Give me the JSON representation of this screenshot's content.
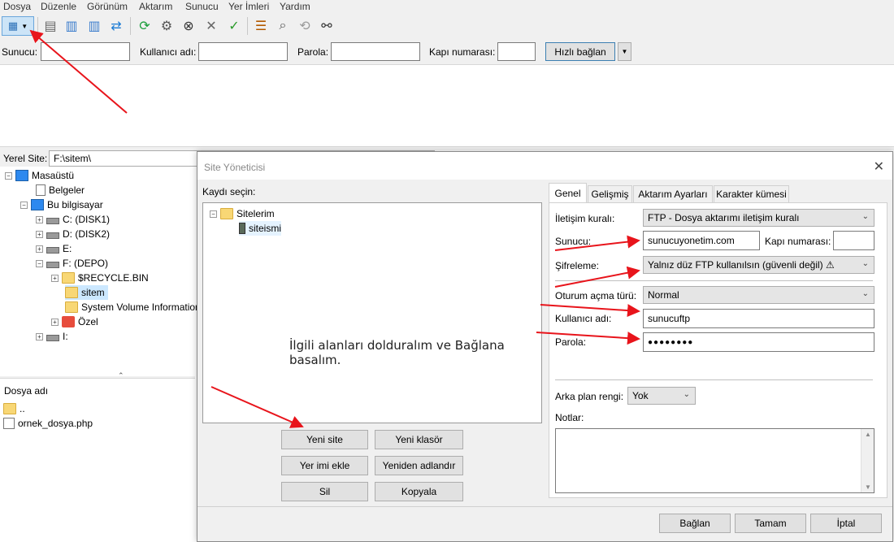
{
  "menu": [
    "Dosya",
    "Düzenle",
    "Görünüm",
    "Aktarım",
    "Sunucu",
    "Yer İmleri",
    "Yardım"
  ],
  "quickconnect": {
    "host_label": "Sunucu:",
    "user_label": "Kullanıcı adı:",
    "pass_label": "Parola:",
    "port_label": "Kapı numarası:",
    "connect_label": "Hızlı bağlan"
  },
  "local": {
    "label": "Yerel Site:",
    "path": "F:\\sitem\\",
    "tree": [
      "Masaüstü",
      "Belgeler",
      "Bu bilgisayar",
      "C: (DISK1)",
      "D: (DISK2)",
      "E:",
      "F: (DEPO)",
      "$RECYCLE.BIN",
      "sitem",
      "System Volume Information",
      "Özel",
      "I:"
    ],
    "files_header": "Dosya adı",
    "files": [
      "..",
      "ornek_dosya.php"
    ]
  },
  "dialog": {
    "title": "Site Yöneticisi",
    "select_label": "Kaydı seçin:",
    "site_root": "Sitelerim",
    "site_item": "siteismi",
    "note": "İlgili alanları dolduralım ve Bağlana basalım.",
    "tabs": [
      "Genel",
      "Gelişmiş",
      "Aktarım Ayarları",
      "Karakter kümesi"
    ],
    "protocol_label": "İletişim kuralı:",
    "protocol_value": "FTP - Dosya aktarımı iletişim kuralı",
    "host_label": "Sunucu:",
    "host_value": "sunucuyonetim.com",
    "port_label": "Kapı numarası:",
    "port_value": "",
    "encryption_label": "Şifreleme:",
    "encryption_value": "Yalnız düz FTP kullanılsın (güvenli değil) ⚠",
    "logon_label": "Oturum açma türü:",
    "logon_value": "Normal",
    "user_label": "Kullanıcı adı:",
    "user_value": "sunucuftp",
    "pass_label": "Parola:",
    "pass_value": "●●●●●●●●",
    "bg_label": "Arka plan rengi:",
    "bg_value": "Yok",
    "notes_label": "Notlar:",
    "buttons": {
      "new_site": "Yeni site",
      "new_folder": "Yeni klasör",
      "new_bookmark": "Yer imi ekle",
      "rename": "Yeniden adlandır",
      "delete": "Sil",
      "copy": "Kopyala",
      "connect": "Bağlan",
      "ok": "Tamam",
      "cancel": "İptal"
    }
  },
  "colors": {
    "arrow": "#e8141b",
    "folder": "#f8d775",
    "selected": "#cce8ff"
  }
}
